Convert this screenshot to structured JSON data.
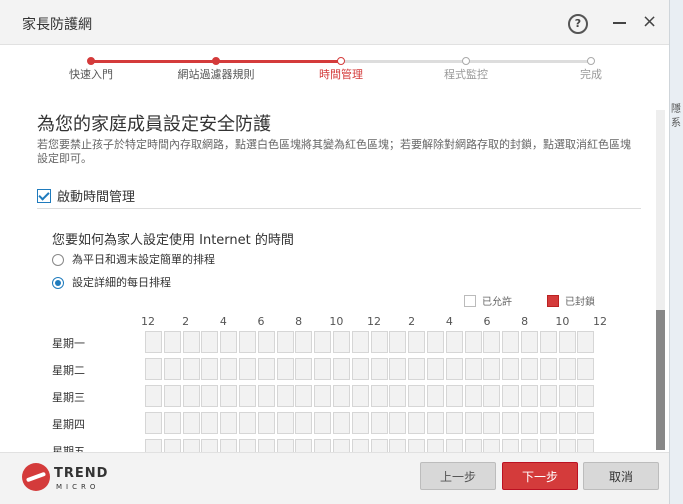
{
  "window": {
    "title": "家長防護網"
  },
  "titlebar": {
    "help_icon": "question-circle-icon",
    "help_glyph": "?",
    "close_glyph": "×"
  },
  "steps": [
    {
      "label": "快速入門",
      "state": "done"
    },
    {
      "label": "網站過濾器規則",
      "state": "done"
    },
    {
      "label": "時間管理",
      "state": "current"
    },
    {
      "label": "程式監控",
      "state": "future"
    },
    {
      "label": "完成",
      "state": "future"
    }
  ],
  "colors": {
    "accent": "#d43b3b",
    "link_blue": "#1f7bbd"
  },
  "main": {
    "heading": "為您的家庭成員設定安全防護",
    "description": "若您要禁止孩子於特定時間內存取網路，點選白色區塊將其變為紅色區塊；若要解除對網路存取的封鎖，點選取消紅色區塊設定即可。",
    "enable_checkbox": {
      "label": "啟動時間管理",
      "checked": true
    },
    "question": "您要如何為家人設定使用 Internet 的時間",
    "options": [
      {
        "label": "為平日和週末設定簡單的排程",
        "selected": false
      },
      {
        "label": "設定詳細的每日排程",
        "selected": true
      }
    ],
    "legend": {
      "allowed": "已允許",
      "blocked": "已封鎖"
    },
    "hours": [
      "12",
      "2",
      "4",
      "6",
      "8",
      "10",
      "12",
      "2",
      "4",
      "6",
      "8",
      "10",
      "12"
    ],
    "days": [
      "星期一",
      "星期二",
      "星期三",
      "星期四",
      "星期五"
    ]
  },
  "footer": {
    "logo_top": "TREND",
    "logo_bottom": "MICRO",
    "prev_label": "上一步",
    "next_label": "下一步",
    "cancel_label": "取消"
  },
  "background": {
    "partial_text_1": "隱",
    "partial_text_2": "系"
  }
}
